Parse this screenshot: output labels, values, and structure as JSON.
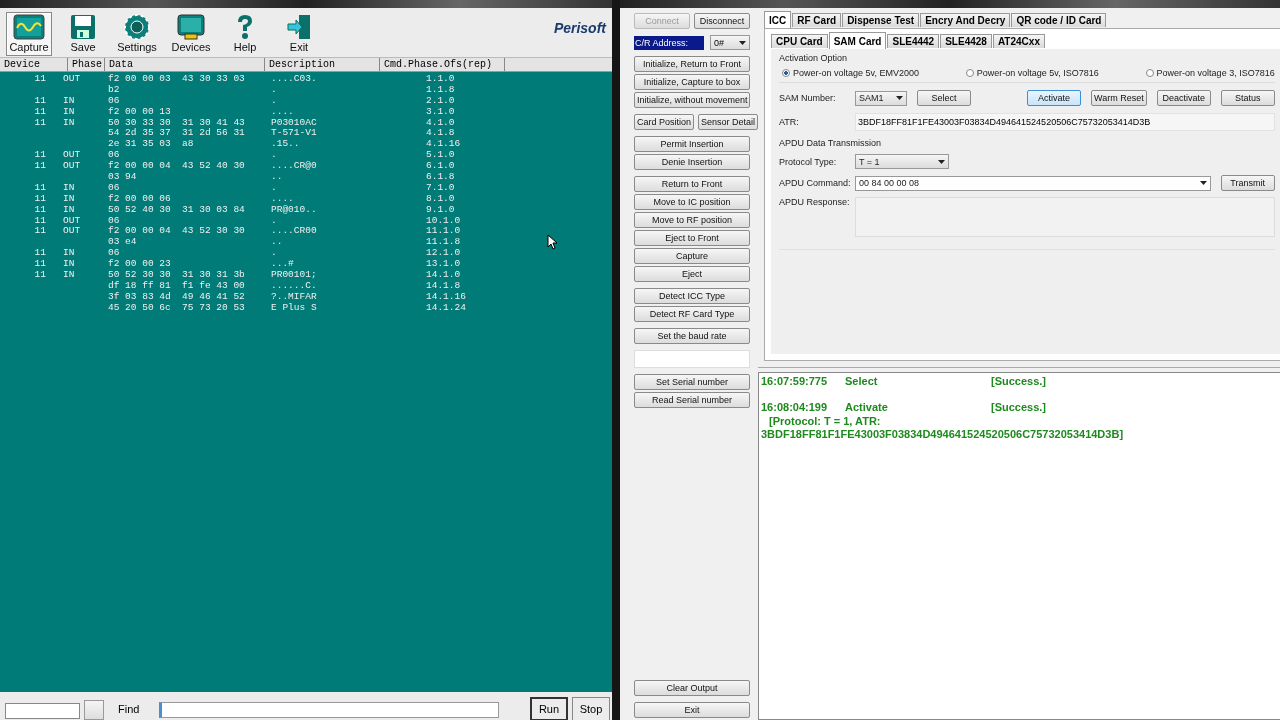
{
  "log_window": {
    "toolbar": [
      {
        "label": "Capture",
        "selected": true
      },
      {
        "label": "Save",
        "selected": false
      },
      {
        "label": "Settings",
        "selected": false
      },
      {
        "label": "Devices",
        "selected": false
      },
      {
        "label": "Help",
        "selected": false
      },
      {
        "label": "Exit",
        "selected": false
      }
    ],
    "logo": "Perisoft",
    "columns": [
      "Device",
      "Phase",
      "Data",
      "Description",
      "Cmd.Phase.Ofs(rep)"
    ],
    "entries": [
      {
        "device": "11",
        "phase": "OUT",
        "lines": [
          {
            "data": "f2 00 00 03  43 30 33 03",
            "desc": "....C03.",
            "ofs": "1.1.0"
          },
          {
            "data": "b2",
            "desc": ".",
            "ofs": "1.1.8"
          }
        ]
      },
      {
        "device": "11",
        "phase": "IN",
        "lines": [
          {
            "data": "06",
            "desc": ".",
            "ofs": "2.1.0"
          }
        ]
      },
      {
        "device": "11",
        "phase": "IN",
        "lines": [
          {
            "data": "f2 00 00 13",
            "desc": "....",
            "ofs": "3.1.0"
          }
        ]
      },
      {
        "device": "11",
        "phase": "IN",
        "lines": [
          {
            "data": "50 30 33 30  31 30 41 43",
            "desc": "P03010AC",
            "ofs": "4.1.0"
          },
          {
            "data": "54 2d 35 37  31 2d 56 31",
            "desc": "T-571-V1",
            "ofs": "4.1.8"
          },
          {
            "data": "2e 31 35 03  a8",
            "desc": ".15..",
            "ofs": "4.1.16"
          }
        ]
      },
      {
        "device": "11",
        "phase": "OUT",
        "lines": [
          {
            "data": "06",
            "desc": ".",
            "ofs": "5.1.0"
          }
        ]
      },
      {
        "device": "11",
        "phase": "OUT",
        "lines": [
          {
            "data": "f2 00 00 04  43 52 40 30",
            "desc": "....CR@0",
            "ofs": "6.1.0"
          },
          {
            "data": "03 94",
            "desc": "..",
            "ofs": "6.1.8"
          }
        ]
      },
      {
        "device": "11",
        "phase": "IN",
        "lines": [
          {
            "data": "06",
            "desc": ".",
            "ofs": "7.1.0"
          }
        ]
      },
      {
        "device": "11",
        "phase": "IN",
        "lines": [
          {
            "data": "f2 00 00 06",
            "desc": "....",
            "ofs": "8.1.0"
          }
        ]
      },
      {
        "device": "11",
        "phase": "IN",
        "lines": [
          {
            "data": "50 52 40 30  31 30 03 84",
            "desc": "PR@010..",
            "ofs": "9.1.0"
          }
        ]
      },
      {
        "device": "11",
        "phase": "OUT",
        "lines": [
          {
            "data": "06",
            "desc": ".",
            "ofs": "10.1.0"
          }
        ]
      },
      {
        "device": "11",
        "phase": "OUT",
        "lines": [
          {
            "data": "f2 00 00 04  43 52 30 30",
            "desc": "....CR00",
            "ofs": "11.1.0"
          },
          {
            "data": "03 e4",
            "desc": "..",
            "ofs": "11.1.8"
          }
        ]
      },
      {
        "device": "11",
        "phase": "IN",
        "lines": [
          {
            "data": "06",
            "desc": ".",
            "ofs": "12.1.0"
          }
        ]
      },
      {
        "device": "11",
        "phase": "IN",
        "lines": [
          {
            "data": "f2 00 00 23",
            "desc": "...#",
            "ofs": "13.1.0"
          }
        ]
      },
      {
        "device": "11",
        "phase": "IN",
        "lines": [
          {
            "data": "50 52 30 30  31 30 31 3b",
            "desc": "PR00101;",
            "ofs": "14.1.0"
          },
          {
            "data": "df 18 ff 81  f1 fe 43 00",
            "desc": "......C.",
            "ofs": "14.1.8"
          },
          {
            "data": "3f 03 83 4d  49 46 41 52",
            "desc": "?..MIFAR",
            "ofs": "14.1.16"
          },
          {
            "data": "45 20 50 6c  75 73 20 53",
            "desc": "E Plus S",
            "ofs": "14.1.24"
          }
        ]
      }
    ],
    "footer": {
      "find_label": "Find",
      "buttons": [
        {
          "label": "Run",
          "selected": true
        },
        {
          "label": "Stop",
          "selected": false
        }
      ]
    }
  },
  "reader_window": {
    "connect_buttons": [
      {
        "label": "Connect",
        "disabled": true
      },
      {
        "label": "Disconnect",
        "disabled": false
      }
    ],
    "address": {
      "label": "C/R Address:",
      "value": "0#"
    },
    "button_groups": [
      {
        "kind": "column",
        "buttons": [
          "Initialize, Return to Front",
          "Initialize, Capture to box",
          "Initialize, without movement"
        ]
      },
      {
        "kind": "row",
        "buttons": [
          "Card Position",
          "Sensor Detail"
        ]
      },
      {
        "kind": "column",
        "buttons": [
          "Permit Insertion",
          "Denie Insertion"
        ]
      },
      {
        "kind": "column",
        "buttons": [
          "Return to Front",
          "Move to IC position",
          "Move to RF position",
          "Eject to Front",
          "Capture",
          "Eject"
        ]
      },
      {
        "kind": "column",
        "buttons": [
          "Detect ICC Type",
          "Detect RF Card Type"
        ]
      },
      {
        "kind": "column",
        "buttons": [
          "Set the baud rate"
        ]
      },
      {
        "kind": "field"
      },
      {
        "kind": "column",
        "buttons": [
          "Set Serial number",
          "Read Serial number"
        ]
      }
    ],
    "bottom_buttons": [
      "Clear Output",
      "Exit"
    ],
    "tabs": [
      {
        "label": "ICC",
        "selected": true
      },
      {
        "label": "RF Card",
        "selected": false
      },
      {
        "label": "Dispense Test",
        "selected": false
      },
      {
        "label": "Encry And Decry",
        "selected": false
      },
      {
        "label": "QR code / ID Card",
        "selected": false
      }
    ],
    "sub_tabs": [
      {
        "label": "CPU Card",
        "selected": false
      },
      {
        "label": "SAM Card",
        "selected": true
      },
      {
        "label": "SLE4442",
        "selected": false
      },
      {
        "label": "SLE4428",
        "selected": false
      },
      {
        "label": "AT24Cxx",
        "selected": false
      }
    ],
    "activation": {
      "title": "Activation Option",
      "options": [
        {
          "label": "Power-on voltage 5v, EMV2000",
          "checked": true
        },
        {
          "label": "Power-on voltage 5v, ISO7816",
          "checked": false
        },
        {
          "label": "Power-on voltage 3, ISO7816",
          "checked": false
        }
      ]
    },
    "sam": {
      "label": "SAM Number:",
      "value": "SAM1",
      "buttons": [
        {
          "label": "Select",
          "focused": false
        },
        {
          "label": "Activate",
          "focused": true
        },
        {
          "label": "Warm Reset",
          "focused": false
        },
        {
          "label": "Deactivate",
          "focused": false
        },
        {
          "label": "Status",
          "focused": false
        }
      ]
    },
    "atr": {
      "label": "ATR:",
      "value": "3BDF18FF81F1FE43003F03834D494641524520506C75732053414D3B"
    },
    "apdu": {
      "title": "APDU Data Transmission",
      "protocol_label": "Protocol Type:",
      "protocol": "T = 1",
      "command_label": "APDU Command:",
      "command": "00 84 00 00 08",
      "transmit": "Transmit",
      "response_label": "APDU Response:"
    },
    "output": [
      {
        "time": "16:07:59:775",
        "action": "Select",
        "result": "[Success.]"
      },
      {
        "time": "16:08:04:199",
        "action": "Activate",
        "result": "[Success.]",
        "details": [
          "[Protocol: T = 1, ATR:",
          "3BDF18FF81F1FE43003F03834D494641524520506C75732053414D3B]"
        ]
      }
    ]
  }
}
